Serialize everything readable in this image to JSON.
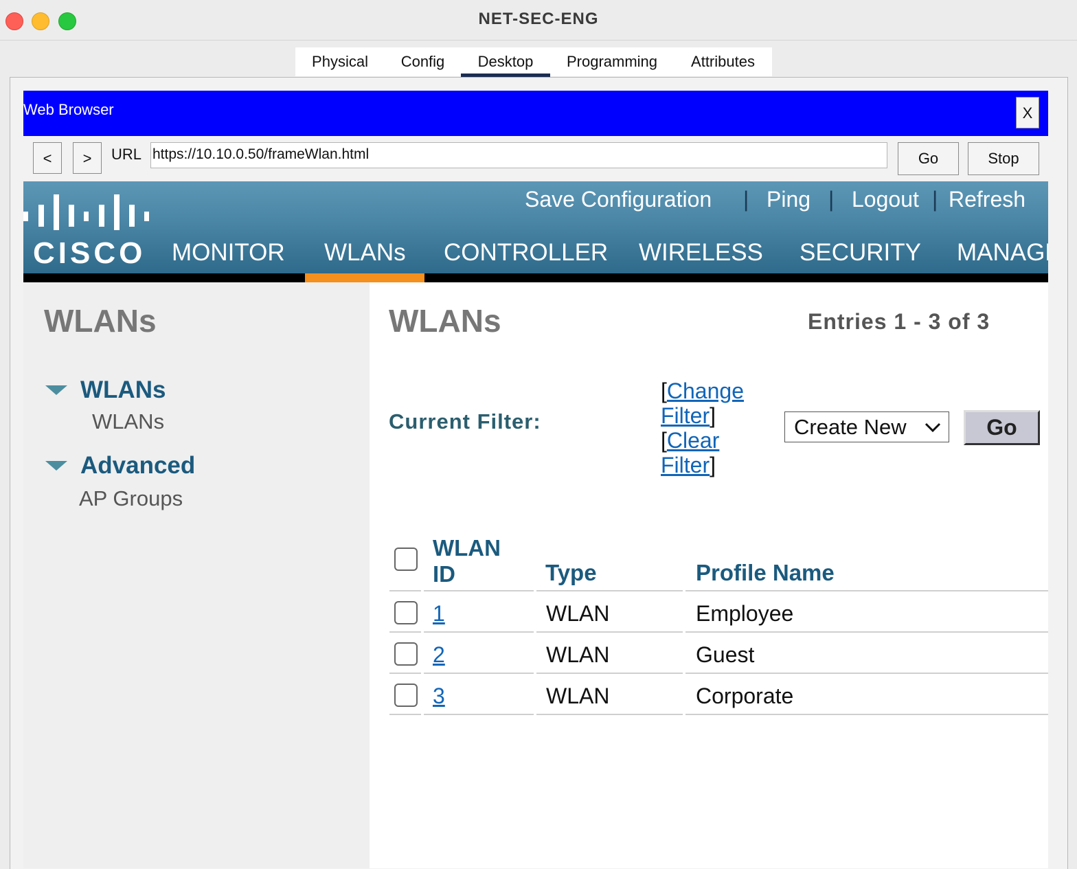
{
  "window": {
    "title": "NET-SEC-ENG"
  },
  "tabs": [
    "Physical",
    "Config",
    "Desktop",
    "Programming",
    "Attributes"
  ],
  "browser": {
    "title": "Web Browser",
    "close_label": "X",
    "back_label": "<",
    "forward_label": ">",
    "url_label": "URL",
    "url_value": "https://10.10.0.50/frameWlan.html",
    "go_label": "Go",
    "stop_label": "Stop"
  },
  "cisco": {
    "logo_text": "CISCO",
    "top_links": [
      "Save Configuration",
      "Ping",
      "Logout",
      "Refresh"
    ],
    "nav": [
      "MONITOR",
      "WLANs",
      "CONTROLLER",
      "WIRELESS",
      "SECURITY",
      "MANAGE"
    ],
    "active_nav": "WLANs"
  },
  "sidebar": {
    "title": "WLANs",
    "sections": [
      {
        "heading": "WLANs",
        "items": [
          "WLANs"
        ]
      },
      {
        "heading": "Advanced",
        "items": [
          "AP Groups"
        ]
      }
    ]
  },
  "main": {
    "title": "WLANs",
    "entries": "Entries 1 - 3 of 3",
    "filter_label": "Current Filter:",
    "change_filter": [
      "Change",
      "Filter"
    ],
    "clear_filter": [
      "Clear",
      "Filter"
    ],
    "create_select": "Create New",
    "go_label": "Go",
    "table": {
      "headers": {
        "id_line1": "WLAN",
        "id_line2": "ID",
        "type": "Type",
        "profile": "Profile Name"
      },
      "rows": [
        {
          "id": "1",
          "type": "WLAN",
          "profile": "Employee"
        },
        {
          "id": "2",
          "type": "WLAN",
          "profile": "Guest"
        },
        {
          "id": "3",
          "type": "WLAN",
          "profile": "Corporate"
        }
      ]
    }
  },
  "colors": {
    "browser_bar": "#0000ff",
    "active_tab_orange": "#f58f1d",
    "cisco_blue": "#4c87a7",
    "heading_blue": "#1b5a7e"
  }
}
